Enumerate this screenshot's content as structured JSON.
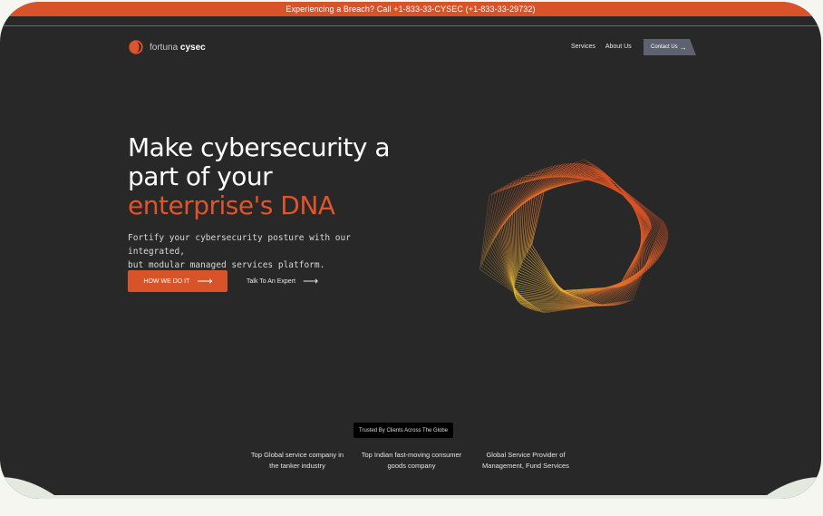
{
  "banner": {
    "text": "Experiencing a Breach? Call +1-833-33-CYSEC (+1-833-33-29732)"
  },
  "brand": {
    "name_light": "fortuna ",
    "name_bold": "cysec",
    "accent": "#e0542c"
  },
  "nav": {
    "links": [
      "Services",
      "About Us"
    ],
    "contact_label": "Contact Us"
  },
  "hero": {
    "title_line1": "Make cybersecurity a",
    "title_line2": "part of your",
    "title_accent": "enterprise's DNA",
    "subtitle_line1": "Fortify your cybersecurity posture with our integrated,",
    "subtitle_line2": "but modular managed services platform.",
    "primary_cta": "HOW WE DO IT",
    "secondary_cta": "Talk To An Expert"
  },
  "trusted": {
    "badge": "Trusted By Clients Across The Globe",
    "clients": [
      {
        "line1": "Top Global service company in",
        "line2": "the tanker industry"
      },
      {
        "line1": "Top Indian fast-moving consumer",
        "line2": "goods company"
      },
      {
        "line1": "Global Service Provider of",
        "line2": "Management, Fund Services"
      }
    ]
  },
  "icons": {
    "arrow": "arrow-right-icon",
    "logo": "fortuna-logo-icon"
  }
}
